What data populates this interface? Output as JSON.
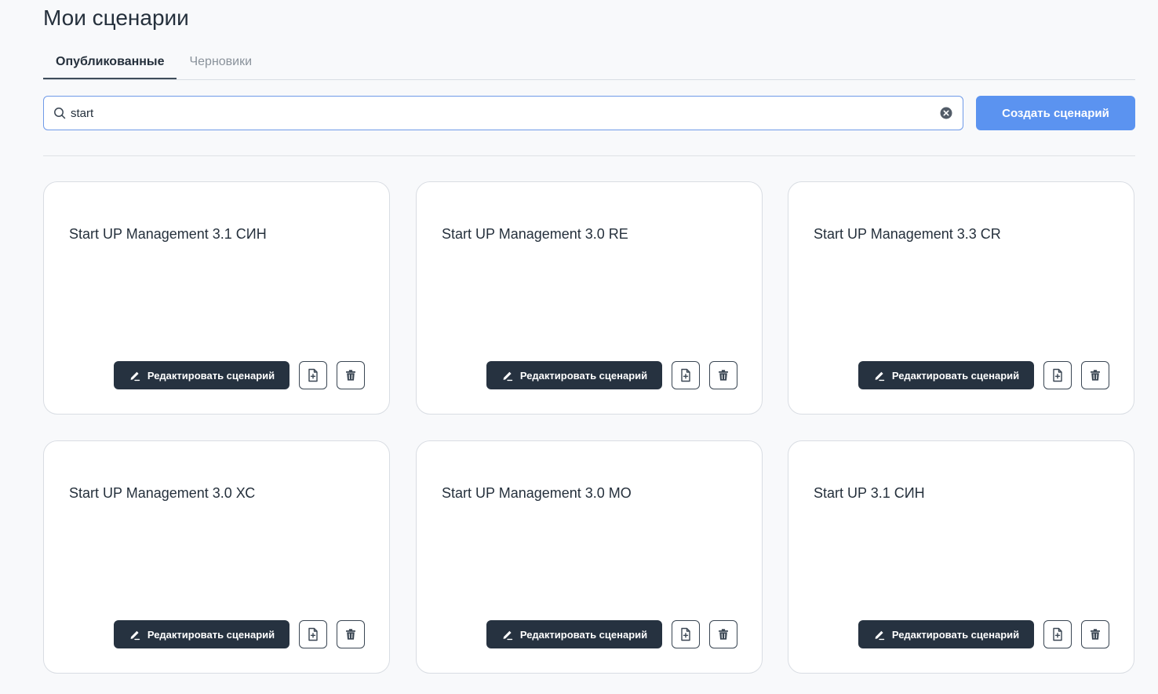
{
  "header": {
    "title": "Мои сценарии"
  },
  "tabs": [
    {
      "label": "Опубликованные",
      "active": true
    },
    {
      "label": "Черновики",
      "active": false
    }
  ],
  "search": {
    "value": "start",
    "placeholder": ""
  },
  "actions": {
    "create_label": "Создать сценарий"
  },
  "card_actions": {
    "edit_label": "Редактировать сценарий"
  },
  "icons": {
    "search": "search-icon",
    "clear": "clear-icon",
    "edit": "pencil-icon",
    "copy": "file-add-icon",
    "delete": "trash-icon"
  },
  "colors": {
    "accent": "#5b93f0",
    "dark_button": "#263240",
    "text": "#25303c",
    "muted": "#8a929b"
  },
  "scenarios": [
    {
      "title": "Start UP Management 3.1 СИН"
    },
    {
      "title": "Start UP Management 3.0 RE"
    },
    {
      "title": "Start UP Management 3.3 CR"
    },
    {
      "title": "Start UP Management 3.0 ХС"
    },
    {
      "title": "Start UP Management 3.0 МО"
    },
    {
      "title": "Start UP 3.1 СИН"
    }
  ]
}
